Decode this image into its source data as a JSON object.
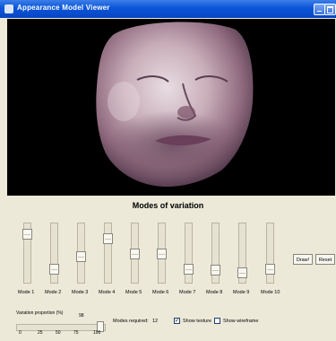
{
  "window": {
    "title": "Appearance Model Viewer"
  },
  "panel": {
    "heading": "Modes of variation"
  },
  "modes": [
    {
      "label": "Mode 1",
      "value": 0.9
    },
    {
      "label": "Mode 2",
      "value": 0.2
    },
    {
      "label": "Mode 3",
      "value": 0.45
    },
    {
      "label": "Mode 4",
      "value": 0.8
    },
    {
      "label": "Mode 5",
      "value": 0.5
    },
    {
      "label": "Mode 6",
      "value": 0.5
    },
    {
      "label": "Mode 7",
      "value": 0.2
    },
    {
      "label": "Mode 8",
      "value": 0.18
    },
    {
      "label": "Mode 9",
      "value": 0.12
    },
    {
      "label": "Mode 10",
      "value": 0.2
    }
  ],
  "buttons": {
    "draw": "Draw!",
    "reset": "Reset"
  },
  "variation": {
    "label": "Variation proportion (%)",
    "value_text": "98",
    "value": 98,
    "ticks": [
      "0",
      "25",
      "50",
      "75",
      "100"
    ]
  },
  "modes_required": {
    "label": "Modes required:",
    "value": "12"
  },
  "show_texture": {
    "label": "Show texture",
    "checked": true
  },
  "show_wireframe": {
    "label": "Show wireframe",
    "checked": false
  },
  "colors": {
    "titlebar": "#0a55d9",
    "viewport": "#000000",
    "panel": "#ece9d8"
  }
}
